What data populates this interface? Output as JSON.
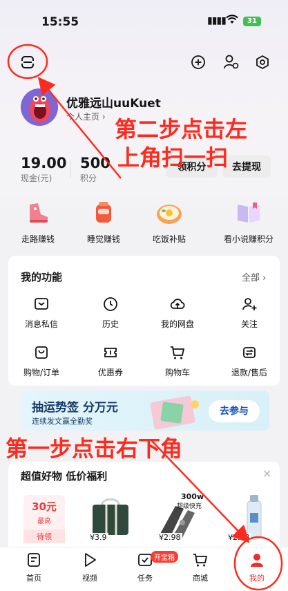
{
  "status_bar": {
    "time": "15:55",
    "battery": "31"
  },
  "profile": {
    "username": "优雅远山uuKuet",
    "homepage_link": "个人主页 ›"
  },
  "overlay": {
    "step_two_line1": "第二步点击左",
    "step_two_line2": "上角扫一扫",
    "step_one": "第一步点击右下角"
  },
  "stats": {
    "cash_value": "19.00",
    "cash_label": "现金(元)",
    "points_value": "500",
    "points_label": "积分",
    "claim_points": "领积分",
    "withdraw": "去提现"
  },
  "earn_items": [
    {
      "label": "走路赚钱",
      "icon": "shoe-icon"
    },
    {
      "label": "睡觉赚钱",
      "icon": "sleep-icon"
    },
    {
      "label": "吃饭补贴",
      "icon": "meal-icon"
    },
    {
      "label": "看小说赚积分",
      "icon": "book-icon"
    }
  ],
  "functions": {
    "title": "我的功能",
    "more": "全部 ›",
    "items": [
      {
        "label": "消息私信",
        "icon": "message-icon"
      },
      {
        "label": "历史",
        "icon": "clock-icon"
      },
      {
        "label": "我的网盘",
        "icon": "cloud-icon"
      },
      {
        "label": "关注",
        "icon": "follow-icon"
      },
      {
        "label": "购物/订单",
        "icon": "order-icon"
      },
      {
        "label": "优惠券",
        "icon": "coupon-icon"
      },
      {
        "label": "购物车",
        "icon": "cart-icon"
      },
      {
        "label": "退款/售后",
        "icon": "refund-icon"
      }
    ]
  },
  "banner": {
    "title": "抽运势签 分万元",
    "subtitle": "连续发文赢全勤奖",
    "button": "去参与"
  },
  "goods": {
    "title": "超值好物 低价福利",
    "close": "✕",
    "coupon": {
      "value": "30元",
      "note": "最高",
      "state": "待领"
    },
    "products": [
      {
        "price": "¥3.9",
        "color": "#2f4a3c"
      },
      {
        "price": "¥2.98",
        "badge_top": "300w",
        "badge_bottom": "超级快充",
        "color": "#444"
      },
      {
        "price": "¥2.68",
        "color": "#dfeaf4"
      }
    ]
  },
  "tabs": [
    {
      "label": "首页",
      "icon": "home-icon"
    },
    {
      "label": "视频",
      "icon": "play-icon"
    },
    {
      "label": "任务",
      "icon": "task-icon",
      "badge": "开宝箱"
    },
    {
      "label": "商城",
      "icon": "shop-icon"
    },
    {
      "label": "我的",
      "icon": "user-icon",
      "active": true
    }
  ],
  "colors": {
    "accent_red": "#ff2a1e",
    "active_tab": "#ea2d2d",
    "banner_blue": "#163a66"
  }
}
